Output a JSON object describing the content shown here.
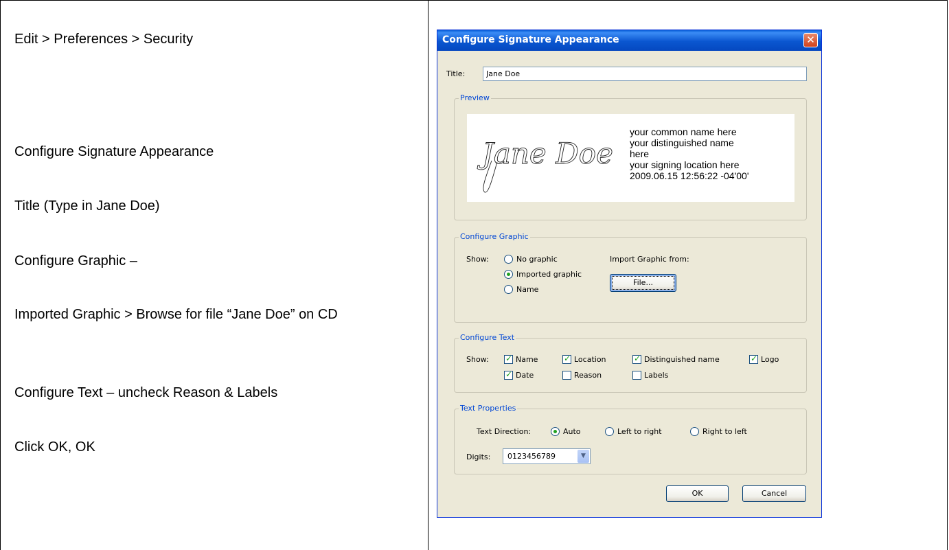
{
  "steps": [
    "Edit > Preferences > Security",
    "Configure Signature Appearance",
    "Title (Type in Jane Doe)",
    "Configure Graphic –",
    "Imported Graphic > Browse for file “Jane Doe” on CD",
    "Configure Text – uncheck Reason & Labels",
    "Click OK, OK"
  ],
  "dialog": {
    "title": "Configure Signature Appearance",
    "close_glyph": "✕",
    "title_field": {
      "label": "Title:",
      "value": "Jane Doe"
    },
    "preview": {
      "group_label": "Preview",
      "signature_text": "Jane Doe",
      "lines": [
        "your common name here",
        "your distinguished name",
        "here",
        "your signing location here",
        "2009.06.15 12:56:22 -04'00'"
      ]
    },
    "configure_graphic": {
      "group_label": "Configure Graphic",
      "show_label": "Show:",
      "options": [
        "No graphic",
        "Imported graphic",
        "Name"
      ],
      "selected": "Imported graphic",
      "import_label": "Import Graphic from:",
      "file_button": "File..."
    },
    "configure_text": {
      "group_label": "Configure Text",
      "show_label": "Show:",
      "checkboxes": [
        {
          "label": "Name",
          "checked": true
        },
        {
          "label": "Location",
          "checked": true
        },
        {
          "label": "Distinguished name",
          "checked": true
        },
        {
          "label": "Logo",
          "checked": true
        },
        {
          "label": "Date",
          "checked": true
        },
        {
          "label": "Reason",
          "checked": false
        },
        {
          "label": "Labels",
          "checked": false
        }
      ]
    },
    "text_properties": {
      "group_label": "Text Properties",
      "direction_label": "Text Direction:",
      "directions": [
        "Auto",
        "Left to right",
        "Right to left"
      ],
      "selected_direction": "Auto",
      "digits_label": "Digits:",
      "digits_value": "0123456789"
    },
    "ok_button": "OK",
    "cancel_button": "Cancel",
    "colors": {
      "titlebar": "#0a56d0",
      "group_label": "#0046d5",
      "check": "#21a121"
    }
  }
}
